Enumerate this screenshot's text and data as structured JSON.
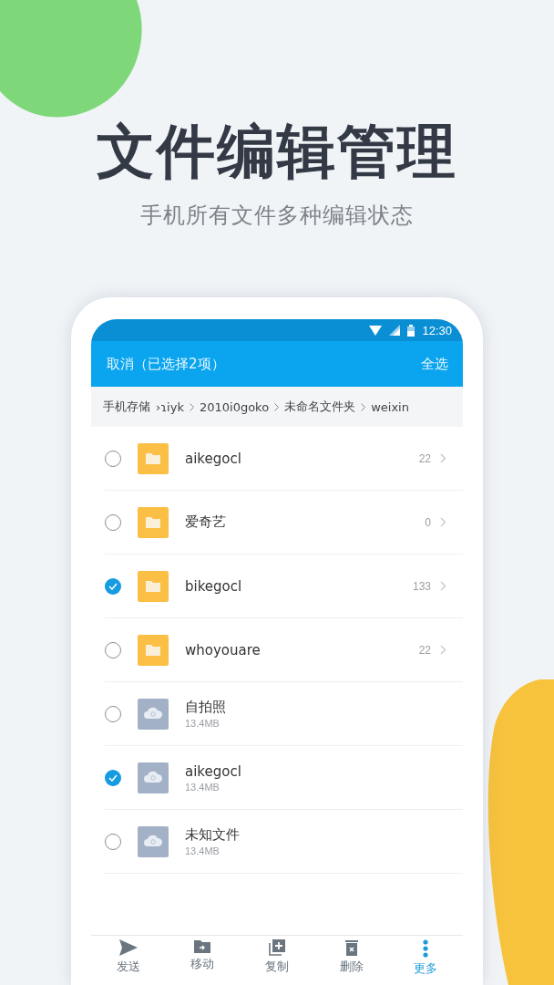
{
  "headline": "文件编辑管理",
  "subtitle": "手机所有文件多种编辑状态",
  "status_bar": {
    "time": "12:30"
  },
  "app_bar": {
    "cancel": "取消（已选择2项）",
    "select_all": "全选"
  },
  "breadcrumb": [
    "手机存储",
    "›ɿiyk",
    "2010i0goko",
    "未命名文件夹",
    "weixin"
  ],
  "files": [
    {
      "kind": "folder",
      "name": "aikegocl",
      "count": "22",
      "selected": false
    },
    {
      "kind": "folder",
      "name": "爱奇艺",
      "count": "0",
      "selected": false
    },
    {
      "kind": "folder",
      "name": "bikegocl",
      "count": "133",
      "selected": true
    },
    {
      "kind": "folder",
      "name": "whoyouare",
      "count": "22",
      "selected": false
    },
    {
      "kind": "file",
      "name": "自拍照",
      "size": "13.4MB",
      "selected": false
    },
    {
      "kind": "file",
      "name": "aikegocl",
      "size": "13.4MB",
      "selected": true
    },
    {
      "kind": "file",
      "name": "未知文件",
      "size": "13.4MB",
      "selected": false
    }
  ],
  "actions": [
    {
      "kind": "send",
      "label": "发送",
      "selected": false
    },
    {
      "kind": "move",
      "label": "移动",
      "selected": false
    },
    {
      "kind": "copy",
      "label": "复制",
      "selected": false
    },
    {
      "kind": "delete",
      "label": "删除",
      "selected": false
    },
    {
      "kind": "more",
      "label": "更多",
      "selected": true
    }
  ]
}
